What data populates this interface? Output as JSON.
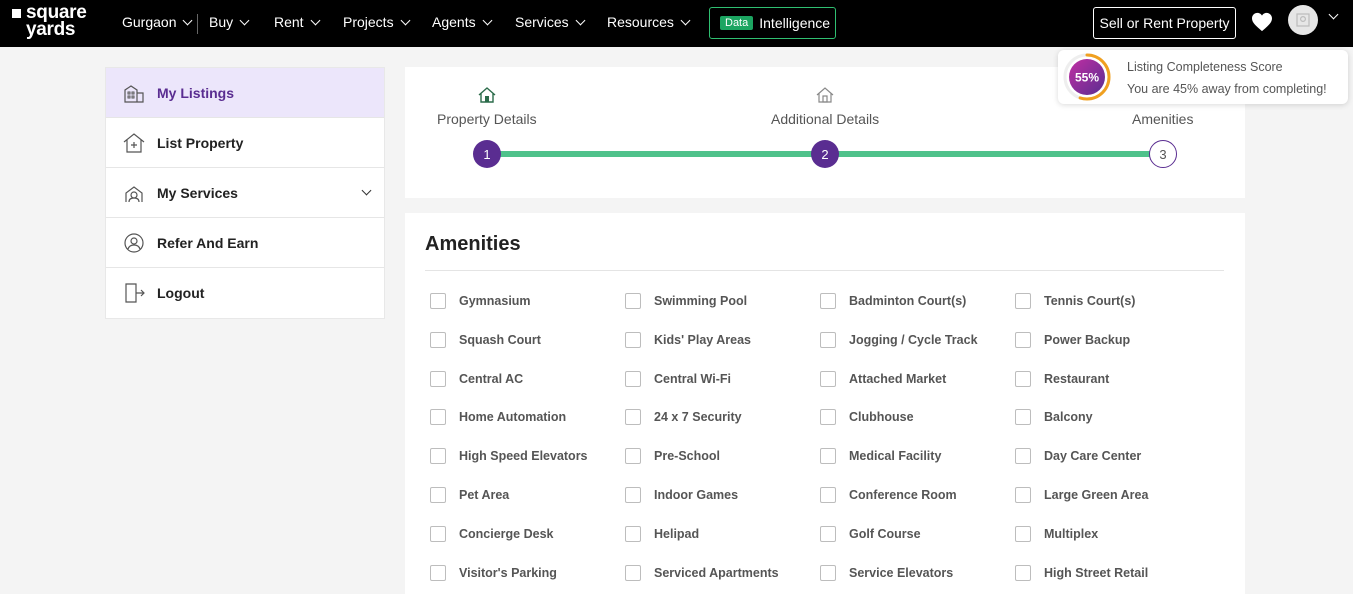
{
  "header": {
    "logo_line1": "square",
    "logo_line2": "yards",
    "city": "Gurgaon",
    "nav": [
      "Buy",
      "Rent",
      "Projects",
      "Agents",
      "Services",
      "Resources"
    ],
    "intelligence_badge": "Data",
    "intelligence_label": "Intelligence",
    "sell_button": "Sell or Rent Property"
  },
  "sidebar": {
    "items": [
      {
        "label": "My Listings",
        "icon": "listings-icon",
        "active": true
      },
      {
        "label": "List Property",
        "icon": "list-property-icon"
      },
      {
        "label": "My Services",
        "icon": "services-icon",
        "expandable": true
      },
      {
        "label": "Refer And Earn",
        "icon": "refer-icon"
      },
      {
        "label": "Logout",
        "icon": "logout-icon"
      }
    ]
  },
  "steps": {
    "items": [
      {
        "title": "Property Details",
        "number": "1",
        "done": true
      },
      {
        "title": "Additional Details",
        "number": "2",
        "done": true
      },
      {
        "title": "Amenities",
        "number": "3",
        "done": false
      }
    ]
  },
  "score": {
    "percent": "55%",
    "value": 0.55,
    "title": "Listing Completeness Score",
    "subtitle": "You are 45% away from completing!"
  },
  "amenities": {
    "title": "Amenities",
    "items": [
      "Gymnasium",
      "Swimming Pool",
      "Badminton Court(s)",
      "Tennis Court(s)",
      "Squash Court",
      "Kids' Play Areas",
      "Jogging / Cycle Track",
      "Power Backup",
      "Central AC",
      "Central Wi-Fi",
      "Attached Market",
      "Restaurant",
      "Home Automation",
      "24 x 7 Security",
      "Clubhouse",
      "Balcony",
      "High Speed Elevators",
      "Pre-School",
      "Medical Facility",
      "Day Care Center",
      "Pet Area",
      "Indoor Games",
      "Conference Room",
      "Large Green Area",
      "Concierge Desk",
      "Helipad",
      "Golf Course",
      "Multiplex",
      "Visitor's Parking",
      "Serviced Apartments",
      "Service Elevators",
      "High Street Retail"
    ]
  },
  "colors": {
    "brand_purple": "#5a2d91",
    "progress_green": "#4fc28b",
    "active_bg": "#ece6fb"
  }
}
